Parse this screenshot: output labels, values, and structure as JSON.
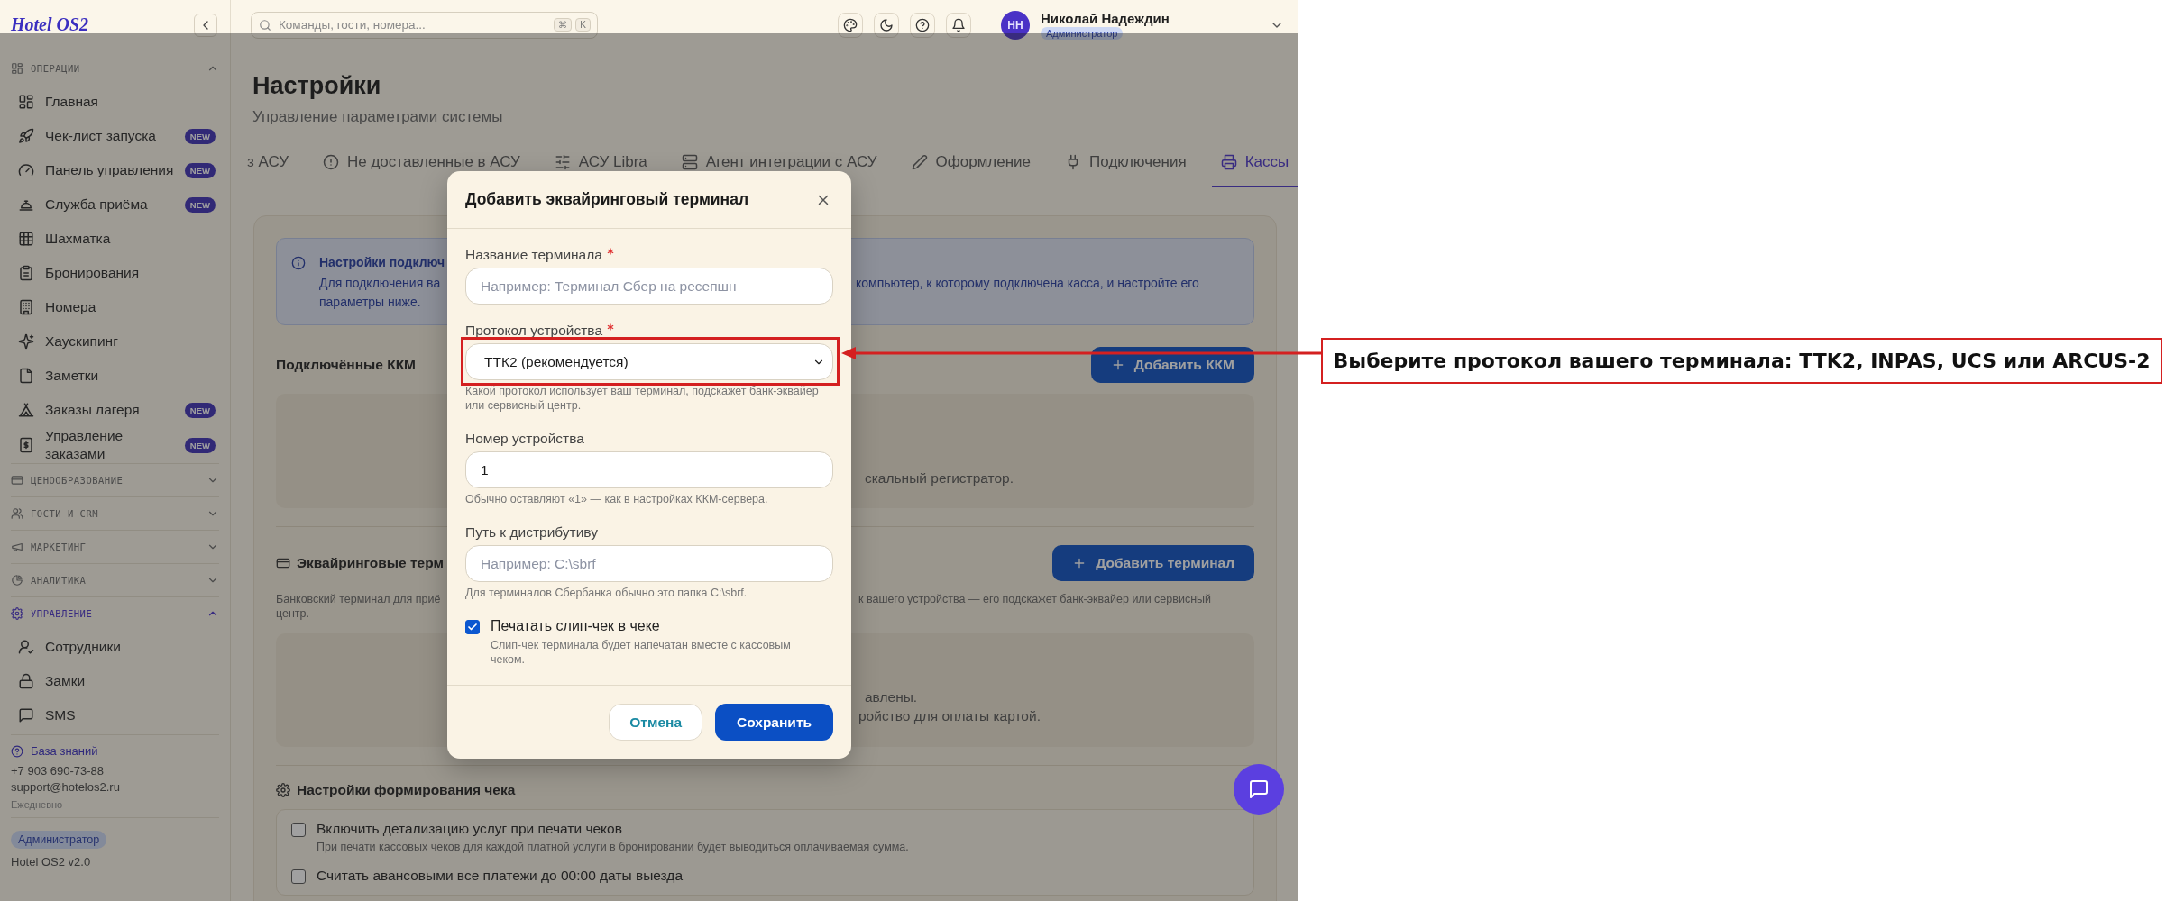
{
  "sidebar": {
    "logo": "Hotel OS2",
    "sections": [
      {
        "title": "ОПЕРАЦИИ",
        "expanded": true,
        "active": false,
        "items": [
          {
            "label": "Главная"
          },
          {
            "label": "Чек-лист запуска",
            "badge": "NEW"
          },
          {
            "label": "Панель управления",
            "badge": "NEW"
          },
          {
            "label": "Служба приёма",
            "badge": "NEW"
          },
          {
            "label": "Шахматка"
          },
          {
            "label": "Бронирования"
          },
          {
            "label": "Номера"
          },
          {
            "label": "Хаускипинг"
          },
          {
            "label": "Заметки"
          },
          {
            "label": "Заказы лагеря",
            "badge": "NEW"
          },
          {
            "label": "Управление заказами",
            "badge": "NEW"
          }
        ]
      },
      {
        "title": "ЦЕНООБРАЗОВАНИЕ",
        "expanded": false,
        "active": false
      },
      {
        "title": "ГОСТИ И CRM",
        "expanded": false,
        "active": false
      },
      {
        "title": "МАРКЕТИНГ",
        "expanded": false,
        "active": false
      },
      {
        "title": "АНАЛИТИКА",
        "expanded": false,
        "active": false
      },
      {
        "title": "УПРАВЛЕНИЕ",
        "expanded": true,
        "active": true,
        "items": [
          {
            "label": "Сотрудники"
          },
          {
            "label": "Замки"
          },
          {
            "label": "SMS"
          }
        ]
      }
    ],
    "help": {
      "link": "База знаний",
      "phone": "+7 903 690-73-88",
      "email": "support@hotelos2.ru",
      "hours": "Ежедневно"
    },
    "role": "Администратор",
    "version": "Hotel OS2 v2.0"
  },
  "header": {
    "search": {
      "placeholder": "Команды, гости, номера...",
      "keys": [
        "⌘",
        "K"
      ]
    },
    "user": {
      "initials": "НН",
      "name": "Николай Надеждин",
      "role": "Администратор"
    }
  },
  "page": {
    "title": "Настройки",
    "subtitle": "Управление параметрами системы",
    "tabs": [
      {
        "label": "з АСУ",
        "selected": false
      },
      {
        "label": "Не доставленные в АСУ",
        "selected": false
      },
      {
        "label": "АСУ Libra",
        "selected": false
      },
      {
        "label": "Агент интеграции с АСУ",
        "selected": false
      },
      {
        "label": "Оформление",
        "selected": false
      },
      {
        "label": "Подключения",
        "selected": false
      },
      {
        "label": "Кассы",
        "selected": true
      }
    ],
    "info": {
      "title": "Настройки подключ",
      "text_left": "Для подключения ва",
      "text_right": "компьютер, к которому подключена касса, и настройте его",
      "text_line2": "параметры ниже."
    },
    "kkm": {
      "title": "Подключённые ККМ",
      "button": "Добавить ККМ",
      "empty_text": "скальный регистратор."
    },
    "acquiring": {
      "title": "Эквайринговые терм",
      "button": "Добавить терминал",
      "description_left": "Банковский терминал для приё",
      "description_right": "к вашего устройства — его подскажет банк-эквайер или сервисный",
      "description_line2": "центр.",
      "empty_lines": [
        "авлены.",
        "ройство для оплаты картой."
      ]
    },
    "receipt": {
      "title": "Настройки формирования чека",
      "options": [
        {
          "label": "Включить детализацию услуг при печати чеков",
          "description": "При печати кассовых чеков для каждой платной услуги в бронировании будет выводиться оплачиваемая сумма.",
          "checked": false
        },
        {
          "label": "Считать авансовыми все платежи до 00:00 даты выезда",
          "checked": false
        }
      ]
    }
  },
  "dialog": {
    "title": "Добавить эквайринговый терминал",
    "fields": [
      {
        "kind": "text",
        "label": "Название терминала",
        "required": true,
        "placeholder": "Например: Терминал Сбер на ресепшн"
      },
      {
        "kind": "select",
        "label": "Протокол устройства",
        "required": true,
        "value": "ТТК2 (рекомендуется)",
        "hint": "Какой протокол использует ваш терминал, подскажет банк-эквайер или сервисный центр."
      },
      {
        "kind": "text",
        "label": "Номер устройства",
        "required": false,
        "value": "1",
        "hint": "Обычно оставляют «1» — как в настройках ККМ-сервера."
      },
      {
        "kind": "text",
        "label": "Путь к дистрибутиву",
        "required": false,
        "placeholder": "Например: C:\\sbrf",
        "hint": "Для терминалов Сбербанка обычно это папка C:\\sbrf."
      },
      {
        "kind": "checkbox",
        "label": "Печатать слип-чек в чеке",
        "checked": true,
        "hint": "Слип-чек терминала будет напечатан вместе с кассовым чеком."
      }
    ],
    "buttons": [
      {
        "label": "Отмена",
        "kind": "secondary"
      },
      {
        "label": "Сохранить",
        "kind": "primary"
      }
    ]
  },
  "annotation": {
    "text": "Выберите протокол вашего терминала: TTK2, INPAS, UCS или ARCUS-2"
  }
}
